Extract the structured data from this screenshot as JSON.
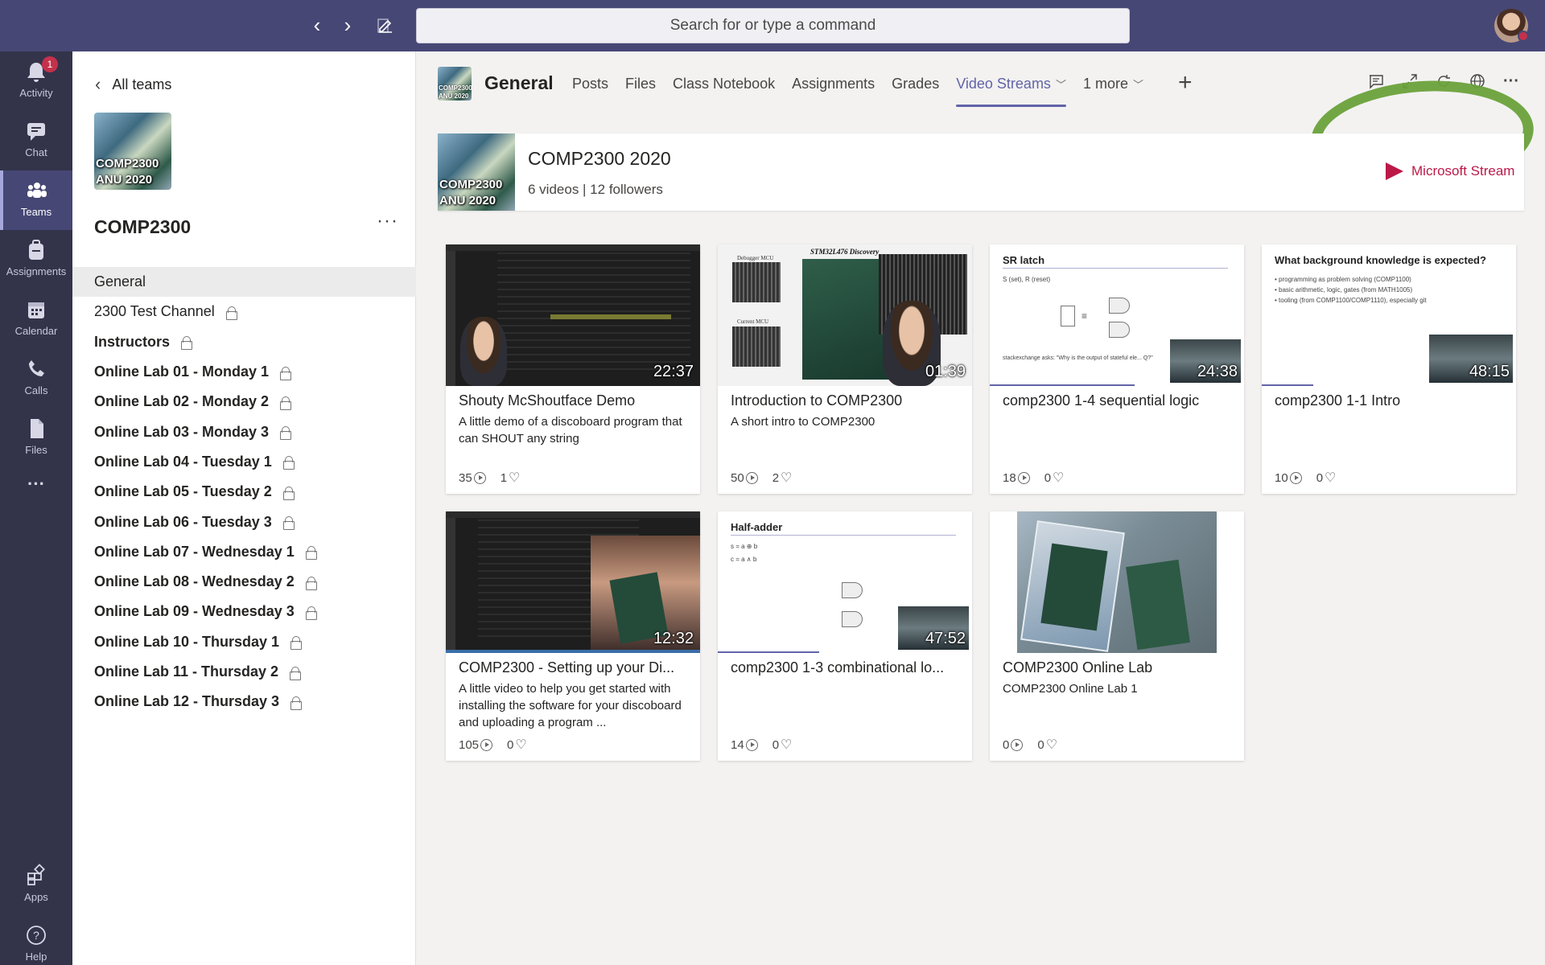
{
  "topbar": {
    "search_placeholder": "Search for or type a command",
    "back_glyph": "‹",
    "forward_glyph": "›"
  },
  "rail": {
    "items": [
      {
        "label": "Activity",
        "icon": "bell-icon",
        "glyph": "🔔",
        "badge": "1"
      },
      {
        "label": "Chat",
        "icon": "chat-icon",
        "glyph": "💬"
      },
      {
        "label": "Teams",
        "icon": "teams-icon",
        "glyph": "👥"
      },
      {
        "label": "Assignments",
        "icon": "assignments-icon",
        "glyph": "🎒"
      },
      {
        "label": "Calendar",
        "icon": "calendar-icon",
        "glyph": "📅"
      },
      {
        "label": "Calls",
        "icon": "phone-icon",
        "glyph": "📞"
      },
      {
        "label": "Files",
        "icon": "file-icon",
        "glyph": "📄"
      },
      {
        "label": "",
        "icon": "more-icon",
        "glyph": "···"
      },
      {
        "label": "Apps",
        "icon": "apps-icon",
        "glyph": "⊞"
      },
      {
        "label": "Help",
        "icon": "help-icon",
        "glyph": "?"
      }
    ]
  },
  "panel": {
    "back_label": "All teams",
    "team_picture_text": "COMP2300 ANU 2020",
    "team_name": "COMP2300",
    "more_glyph": "···",
    "channels": [
      {
        "label": "General"
      },
      {
        "label": "2300 Test Channel"
      },
      {
        "label": "Instructors"
      },
      {
        "label": "Online Lab 01 - Monday 1"
      },
      {
        "label": "Online Lab 02 - Monday 2"
      },
      {
        "label": "Online Lab 03 - Monday 3"
      },
      {
        "label": "Online Lab 04 - Tuesday 1"
      },
      {
        "label": "Online Lab 05 - Tuesday 2"
      },
      {
        "label": "Online Lab 06 - Tuesday 3"
      },
      {
        "label": "Online Lab 07 - Wednesday 1"
      },
      {
        "label": "Online Lab 08 - Wednesday 2"
      },
      {
        "label": "Online Lab 09 - Wednesday 3"
      },
      {
        "label": "Online Lab 10 - Thursday 1"
      },
      {
        "label": "Online Lab 11 - Thursday 2"
      },
      {
        "label": "Online Lab 12 - Thursday 3"
      }
    ]
  },
  "header": {
    "channel_picture_text": "COMP2300 ANU 2020",
    "channel_name": "General",
    "tabs": [
      "Posts",
      "Files",
      "Class Notebook",
      "Assignments",
      "Grades",
      "Video Streams",
      "1 more"
    ],
    "active_tab": "Video Streams",
    "add_tab_glyph": "+",
    "annotation_color": "#6aa13a"
  },
  "stream": {
    "picture_text": "COMP2300 ANU 2020",
    "title": "COMP2300 2020",
    "subtitle": "6 videos | 12 followers",
    "brand": "Microsoft Stream",
    "brand_color": "#bc1948"
  },
  "videos": [
    {
      "title": "Shouty McShoutface Demo",
      "desc": "A little demo of a discoboard program that can SHOUT any string",
      "duration": "22:37",
      "views": "35",
      "likes": "1"
    },
    {
      "title": "Introduction to COMP2300",
      "desc": "A short intro to COMP2300",
      "duration": "01:39",
      "views": "50",
      "likes": "2",
      "thumb_caption": "STM32L476 Discovery",
      "thumb_label_a": "Debugger MCU",
      "thumb_label_b": "Current MCU"
    },
    {
      "title": "comp2300 1-4 sequential logic",
      "desc": "",
      "duration": "24:38",
      "views": "18",
      "likes": "0",
      "slide_title": "SR latch",
      "slide_text": "S (set), R (reset)",
      "slide_foot": "stackexchange asks: \"Why is the output of stateful ele... Q?\""
    },
    {
      "title": "comp2300 1-1 Intro",
      "desc": "",
      "duration": "48:15",
      "views": "10",
      "likes": "0",
      "slide_title": "What background knowledge is expected?",
      "slide_bullets": [
        "• programming as problem solving (COMP1100)",
        "• basic arithmetic, logic, gates (from MATH1005)",
        "• tooling (from COMP1100/COMP1110), especially git"
      ]
    },
    {
      "title": "COMP2300 - Setting up your Di...",
      "desc": "A little video to help you get started with installing the software for your discoboard and uploading a program ...",
      "duration": "12:32",
      "views": "105",
      "likes": "0"
    },
    {
      "title": "comp2300 1-3 combinational lo...",
      "desc": "",
      "duration": "47:52",
      "views": "14",
      "likes": "0",
      "slide_title": "Half-adder",
      "slide_text_a": "s = a ⊕ b",
      "slide_text_b": "c = a ∧ b"
    },
    {
      "title": "COMP2300 Online Lab",
      "desc": "COMP2300 Online Lab 1",
      "duration": "",
      "views": "0",
      "likes": "0"
    }
  ]
}
